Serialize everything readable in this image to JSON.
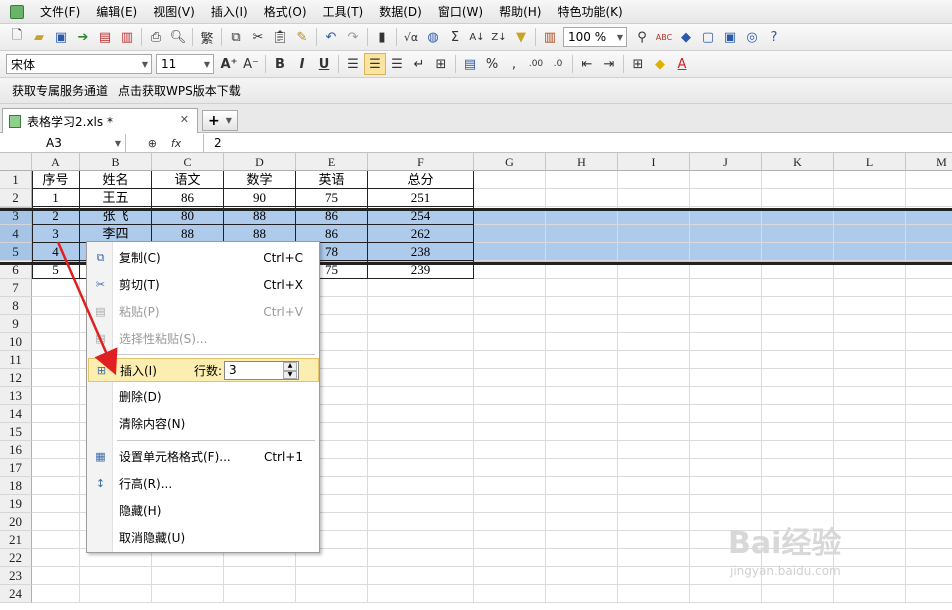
{
  "app": {
    "menus": [
      "文件(F)",
      "编辑(E)",
      "视图(V)",
      "插入(I)",
      "格式(O)",
      "工具(T)",
      "数据(D)",
      "窗口(W)",
      "帮助(H)",
      "特色功能(K)"
    ]
  },
  "toolbar": {
    "zoom": "100 %",
    "traditional_label": "繁"
  },
  "format_toolbar": {
    "font_name": "宋体",
    "font_size": "11",
    "bold": "B",
    "italic": "I",
    "underline": "U"
  },
  "linkbar": {
    "links": [
      "获取专属服务通道",
      "点击获取WPS版本下载"
    ]
  },
  "tabs": {
    "doc_title": "表格学习2.xls *",
    "new_tab_label": "+"
  },
  "formula_bar": {
    "name_box": "A3",
    "fx_label": "fx",
    "value": "2"
  },
  "sheet": {
    "columns": [
      "A",
      "B",
      "C",
      "D",
      "E",
      "F",
      "G",
      "H",
      "I",
      "J",
      "K",
      "L",
      "M"
    ],
    "row_numbers": [
      "1",
      "2",
      "3",
      "4",
      "5",
      "6",
      "7",
      "8",
      "9",
      "10",
      "11",
      "12",
      "13",
      "14",
      "15",
      "16",
      "17",
      "18",
      "19",
      "20",
      "21",
      "22",
      "23",
      "24"
    ],
    "selected_rows": [
      "3",
      "4",
      "5"
    ],
    "table": [
      [
        "序号",
        "姓名",
        "语文",
        "数学",
        "英语",
        "总分"
      ],
      [
        "1",
        "王五",
        "86",
        "90",
        "75",
        "251"
      ],
      [
        "2",
        "张飞",
        "80",
        "88",
        "86",
        "254"
      ],
      [
        "3",
        "李四",
        "88",
        "88",
        "86",
        "262"
      ],
      [
        "4",
        "",
        "",
        "",
        "78",
        "238"
      ],
      [
        "5",
        "",
        "",
        "",
        "75",
        "239"
      ]
    ]
  },
  "context_menu": {
    "items": [
      {
        "label": "复制(C)",
        "shortcut": "Ctrl+C",
        "disabled": false,
        "icon": "copy-icon"
      },
      {
        "label": "剪切(T)",
        "shortcut": "Ctrl+X",
        "disabled": false,
        "icon": "scissors-icon"
      },
      {
        "label": "粘贴(P)",
        "shortcut": "Ctrl+V",
        "disabled": true,
        "icon": "paste-icon"
      },
      {
        "label": "选择性粘贴(S)...",
        "shortcut": "",
        "disabled": true,
        "icon": "paste-special-icon"
      },
      {
        "label": "插入(I)",
        "shortcut": "",
        "disabled": false,
        "icon": "insert-rows-icon"
      },
      {
        "label": "删除(D)",
        "shortcut": "",
        "disabled": false,
        "icon": ""
      },
      {
        "label": "清除内容(N)",
        "shortcut": "",
        "disabled": false,
        "icon": ""
      },
      {
        "label": "设置单元格格式(F)...",
        "shortcut": "Ctrl+1",
        "disabled": false,
        "icon": "format-cells-icon"
      },
      {
        "label": "行高(R)...",
        "shortcut": "",
        "disabled": false,
        "icon": "row-height-icon"
      },
      {
        "label": "隐藏(H)",
        "shortcut": "",
        "disabled": false,
        "icon": ""
      },
      {
        "label": "取消隐藏(U)",
        "shortcut": "",
        "disabled": false,
        "icon": ""
      }
    ],
    "row_count_label": "行数:",
    "row_count_value": "3"
  },
  "watermark": {
    "brand": "Bai经验",
    "url": "jingyan.baidu.com"
  },
  "colors": {
    "selection": "#aecbeb",
    "highlight": "#fbeeb0",
    "arrow": "#e02020"
  }
}
